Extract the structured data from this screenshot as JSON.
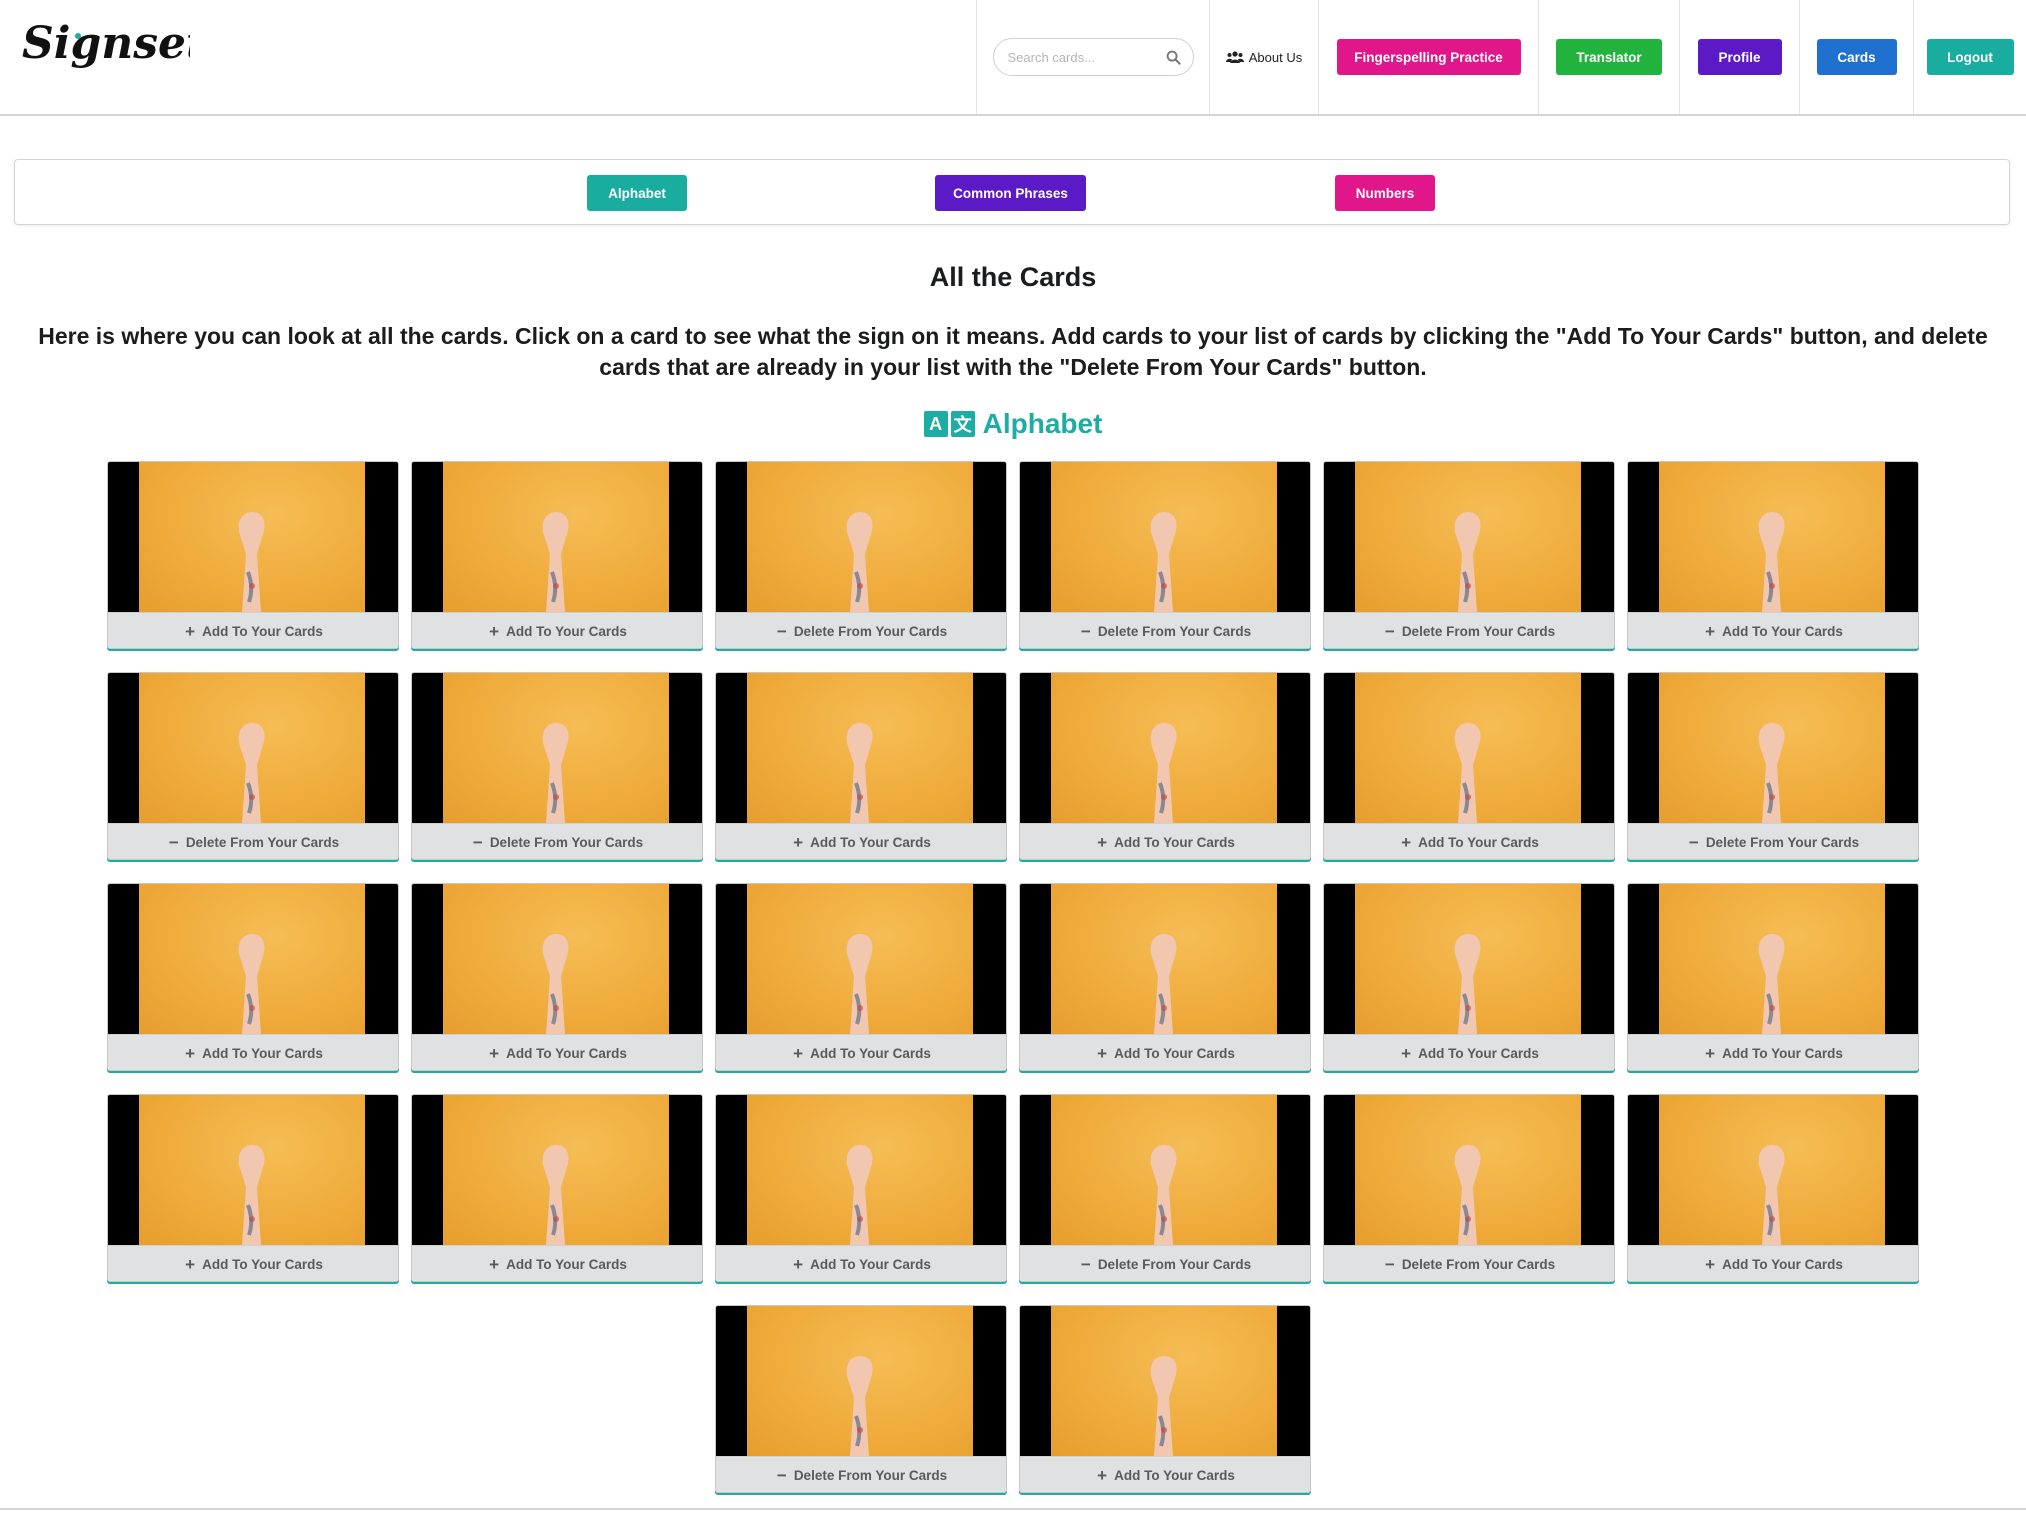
{
  "header": {
    "logo_text": "Signsetta",
    "search": {
      "placeholder": "Search cards...",
      "value": ""
    },
    "about_label": "About Us",
    "nav_buttons": [
      {
        "label": "Fingerspelling Practice",
        "color": "#e0168a"
      },
      {
        "label": "Translator",
        "color": "#21b33e"
      },
      {
        "label": "Profile",
        "color": "#5b1ac6"
      },
      {
        "label": "Cards",
        "color": "#2070d0"
      },
      {
        "label": "Logout",
        "color": "#18ad9f"
      }
    ]
  },
  "categories": [
    {
      "label": "Alphabet",
      "color": "#18ad9f"
    },
    {
      "label": "Common Phrases",
      "color": "#5b1ac6"
    },
    {
      "label": "Numbers",
      "color": "#e0168a"
    }
  ],
  "main": {
    "title": "All the Cards",
    "description": "Here is where you can look at all the cards. Click on a card to see what the sign on it means. Add cards to your list of cards by clicking the \"Add To Your Cards\" button, and delete cards that are already in your list with the \"Delete From Your Cards\" button.",
    "section_title": "Alphabet",
    "section_icon_glyphs": [
      "A",
      "文"
    ],
    "accent_color": "#1eada4"
  },
  "card_actions": {
    "add": "Add To Your Cards",
    "delete": "Delete From Your Cards",
    "add_symbol": "+",
    "delete_symbol": "−"
  },
  "cards": [
    {
      "action": "add"
    },
    {
      "action": "add"
    },
    {
      "action": "delete"
    },
    {
      "action": "delete"
    },
    {
      "action": "delete"
    },
    {
      "action": "add"
    },
    {
      "action": "delete"
    },
    {
      "action": "delete"
    },
    {
      "action": "add"
    },
    {
      "action": "add"
    },
    {
      "action": "add"
    },
    {
      "action": "delete"
    },
    {
      "action": "add"
    },
    {
      "action": "add"
    },
    {
      "action": "add"
    },
    {
      "action": "add"
    },
    {
      "action": "add"
    },
    {
      "action": "add"
    },
    {
      "action": "add"
    },
    {
      "action": "add"
    },
    {
      "action": "add"
    },
    {
      "action": "delete"
    },
    {
      "action": "delete"
    },
    {
      "action": "add"
    },
    {
      "action": "delete"
    },
    {
      "action": "add"
    }
  ]
}
